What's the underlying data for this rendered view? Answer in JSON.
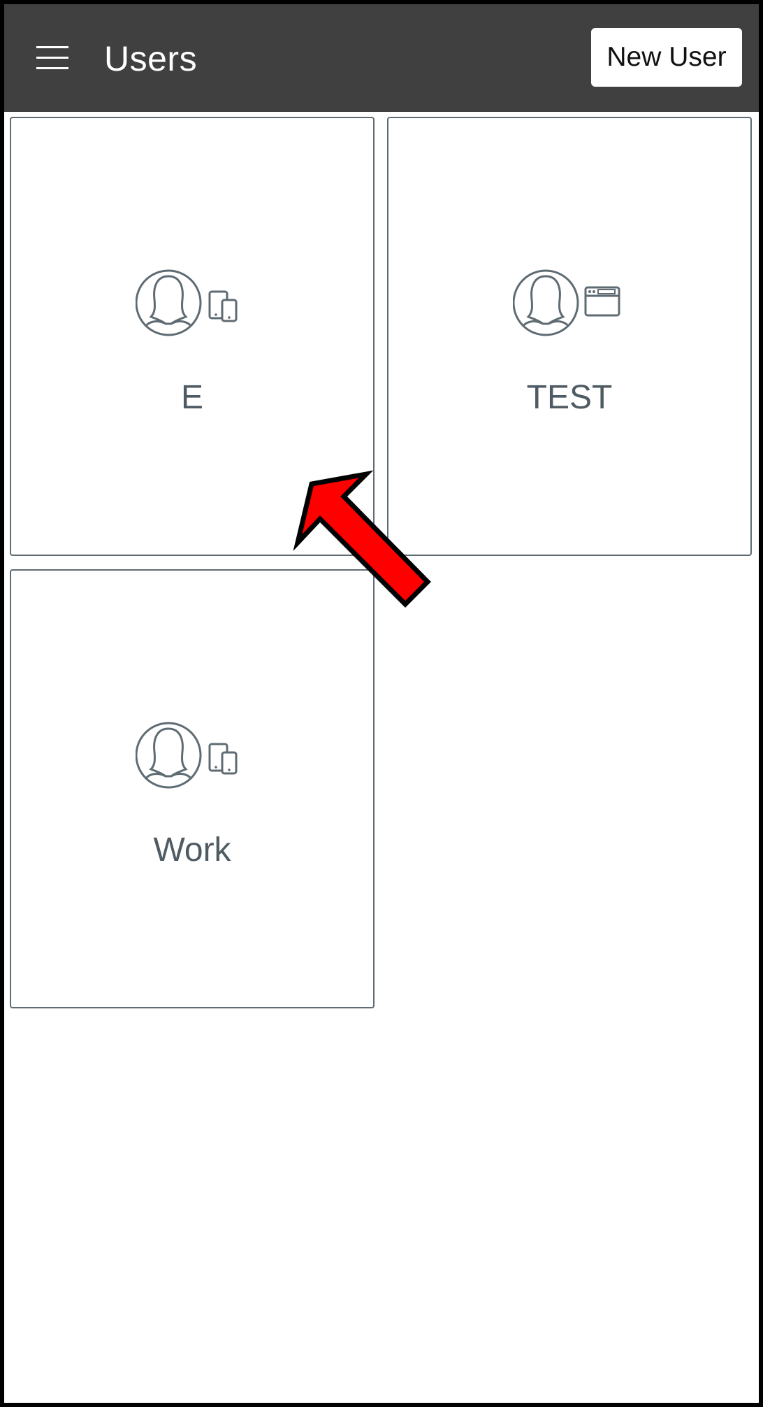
{
  "header": {
    "title": "Users",
    "menu_icon": "hamburger-menu-icon",
    "new_user_label": "New User"
  },
  "users": [
    {
      "name": "E",
      "avatar_icon": "user-avatar-icon",
      "device_icon": "devices-icon"
    },
    {
      "name": "TEST",
      "avatar_icon": "user-avatar-icon",
      "device_icon": "browser-window-icon"
    },
    {
      "name": "Work",
      "avatar_icon": "user-avatar-icon",
      "device_icon": "devices-icon"
    }
  ],
  "overlay": {
    "arrow_icon": "red-arrow-icon",
    "arrow_color": "#ff0000"
  },
  "colors": {
    "appbar": "#404040",
    "tile_border": "#5f6b72",
    "label": "#4f5b63"
  }
}
